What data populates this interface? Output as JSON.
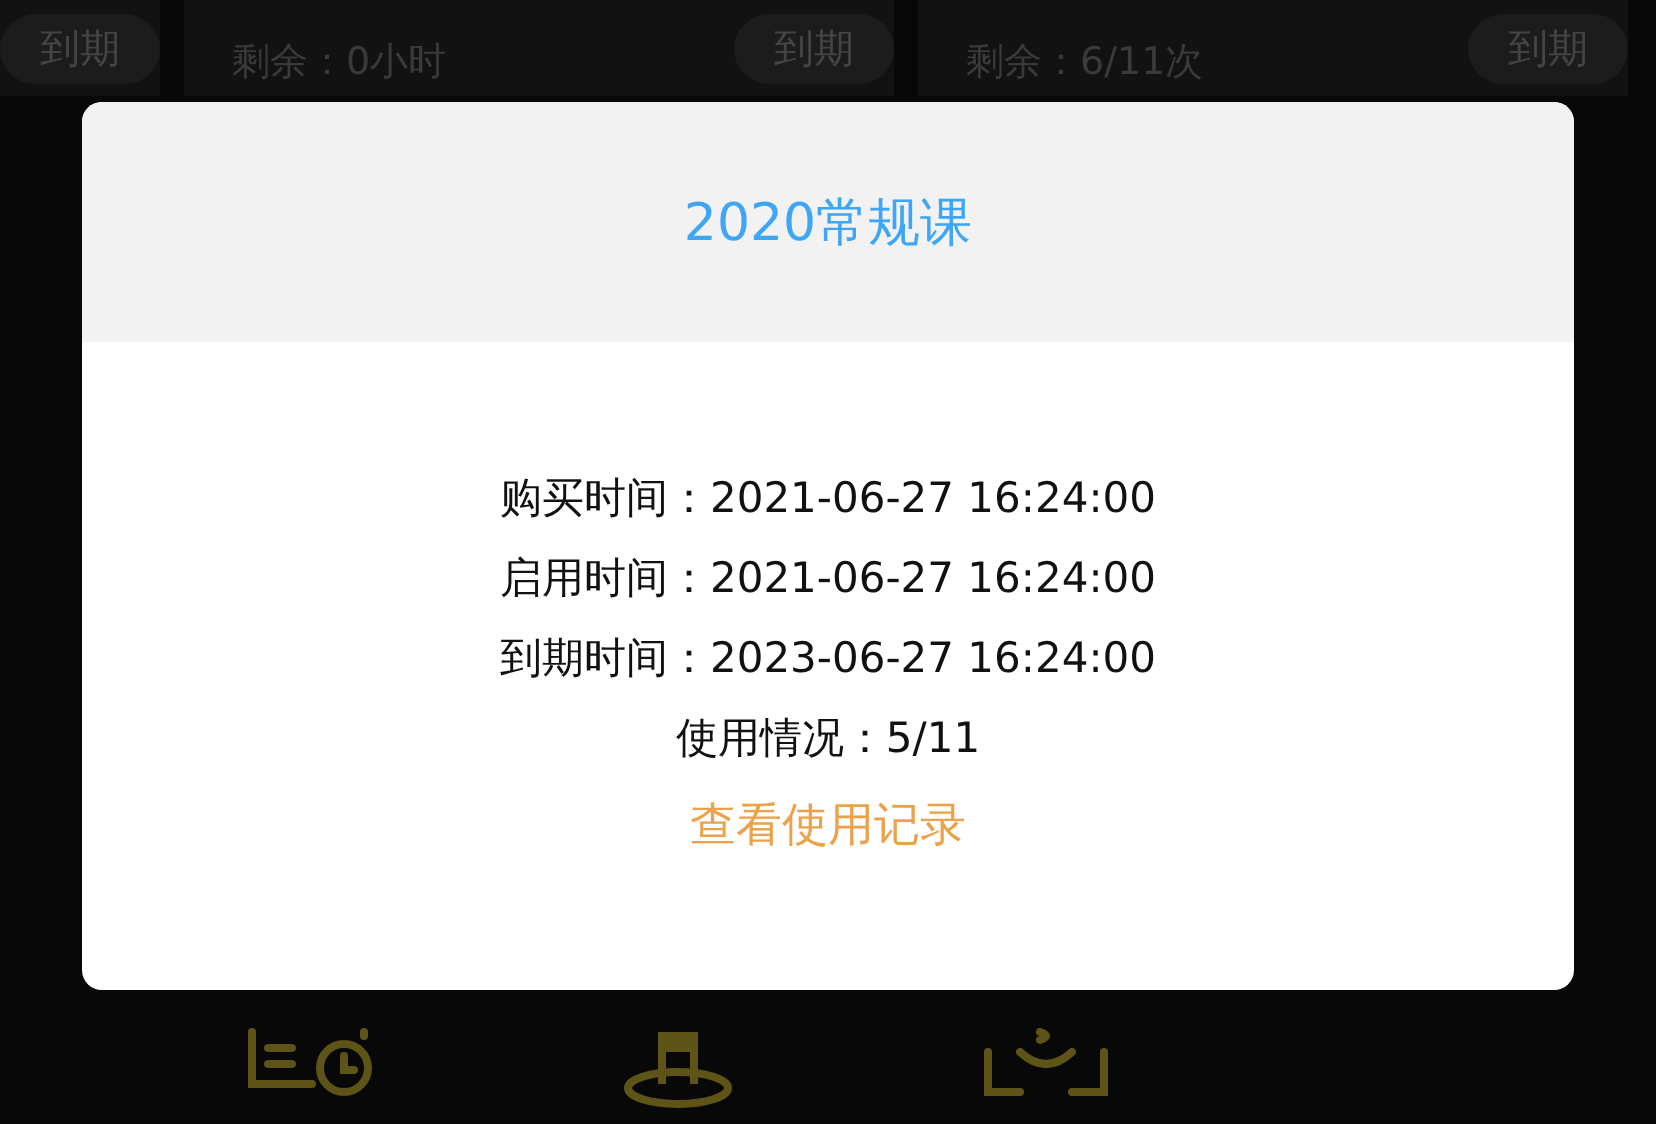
{
  "background_cards": [
    {
      "badge": "到期"
    },
    {
      "remaining": "剩余：0小时",
      "badge": "到期"
    },
    {
      "remaining": "剩余：6/11次",
      "badge": "到期"
    }
  ],
  "background_shortcuts": [
    {
      "kind": "record"
    },
    {
      "kind": "stage"
    },
    {
      "kind": "scan"
    }
  ],
  "dialog": {
    "title": "2020常规课",
    "lines": [
      {
        "label": "购买时间：",
        "value": "2021-06-27 16:24:00"
      },
      {
        "label": "启用时间：",
        "value": "2021-06-27 16:24:00"
      },
      {
        "label": "到期时间：",
        "value": "2023-06-27 16:24:00"
      },
      {
        "label": "使用情况：",
        "value": "5/11"
      }
    ],
    "link": "查看使用记录"
  }
}
